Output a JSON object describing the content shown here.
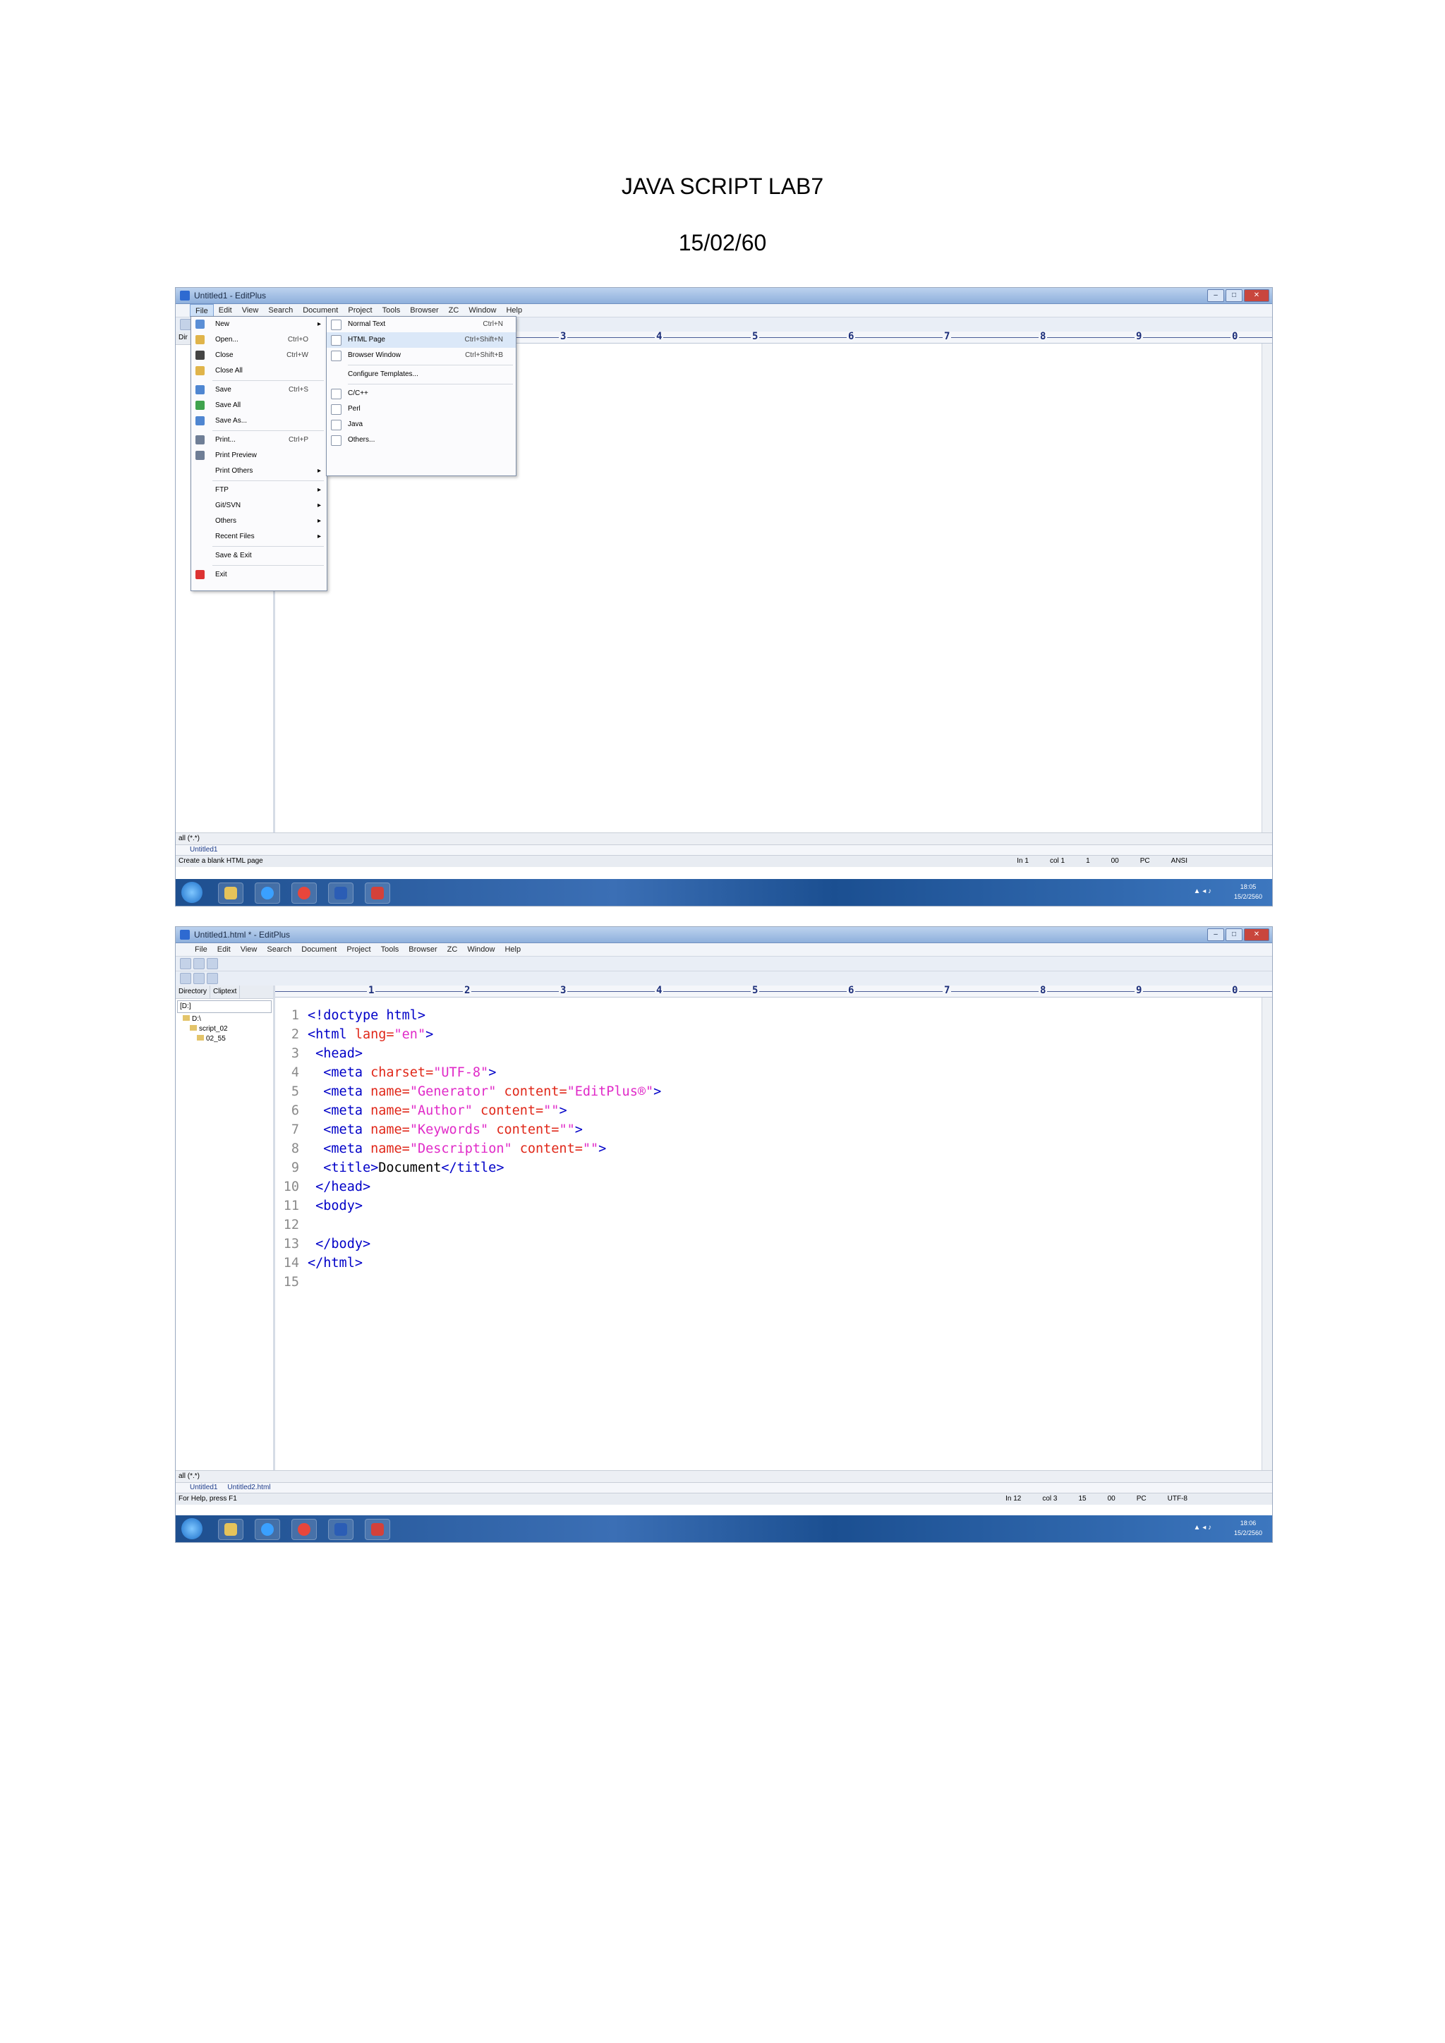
{
  "document": {
    "title": "JAVA SCRIPT LAB7",
    "date": "15/02/60"
  },
  "screenshot1": {
    "window_title": "Untitled1 - EditPlus",
    "menu": [
      "File",
      "Edit",
      "View",
      "Search",
      "Document",
      "Project",
      "Tools",
      "Browser",
      "ZC",
      "Window",
      "Help"
    ],
    "file_menu": [
      {
        "label": "New",
        "shortcut": "",
        "arrow": "▸"
      },
      {
        "label": "Open...",
        "shortcut": "Ctrl+O",
        "arrow": ""
      },
      {
        "label": "Close",
        "shortcut": "Ctrl+W",
        "arrow": ""
      },
      {
        "label": "Close All",
        "shortcut": "",
        "arrow": ""
      },
      {
        "label": "Save",
        "shortcut": "Ctrl+S",
        "arrow": ""
      },
      {
        "label": "Save All",
        "shortcut": "",
        "arrow": ""
      },
      {
        "label": "Save As...",
        "shortcut": "",
        "arrow": ""
      },
      {
        "label": "Print...",
        "shortcut": "Ctrl+P",
        "arrow": ""
      },
      {
        "label": "Print Preview",
        "shortcut": "",
        "arrow": ""
      },
      {
        "label": "Print Others",
        "shortcut": "",
        "arrow": "▸"
      },
      {
        "label": "FTP",
        "shortcut": "",
        "arrow": "▸"
      },
      {
        "label": "Git/SVN",
        "shortcut": "",
        "arrow": "▸"
      },
      {
        "label": "Others",
        "shortcut": "",
        "arrow": "▸"
      },
      {
        "label": "Recent Files",
        "shortcut": "",
        "arrow": "▸"
      },
      {
        "label": "Save & Exit",
        "shortcut": "",
        "arrow": ""
      },
      {
        "label": "Exit",
        "shortcut": "",
        "arrow": ""
      }
    ],
    "new_submenu": [
      {
        "label": "Normal Text",
        "shortcut": "Ctrl+N"
      },
      {
        "label": "HTML Page",
        "shortcut": "Ctrl+Shift+N"
      },
      {
        "label": "Browser Window",
        "shortcut": "Ctrl+Shift+B"
      },
      {
        "label": "Configure Templates...",
        "shortcut": ""
      },
      {
        "label": "C/C++",
        "shortcut": ""
      },
      {
        "label": "Perl",
        "shortcut": ""
      },
      {
        "label": "Java",
        "shortcut": ""
      },
      {
        "label": "Others...",
        "shortcut": ""
      }
    ],
    "filter": "all (*.*)",
    "doc_tab": "Untitled1",
    "status_text": "Create a blank HTML page",
    "status_right": [
      "In 1",
      "col 1",
      "1",
      "00",
      "PC",
      "ANSI"
    ],
    "clock": {
      "time": "18:05",
      "date": "15/2/2560"
    }
  },
  "screenshot2": {
    "window_title": "Untitled1.html * - EditPlus",
    "menu": [
      "File",
      "Edit",
      "View",
      "Search",
      "Document",
      "Project",
      "Tools",
      "Browser",
      "ZC",
      "Window",
      "Help"
    ],
    "panel_tabs": [
      "Directory",
      "Cliptext"
    ],
    "drive": "[D:]",
    "tree": [
      "D:\\",
      "script_02",
      "02_55"
    ],
    "filter": "all (*.*)",
    "doc_tabs": [
      "Untitled1",
      "Untitled2.html"
    ],
    "code": [
      [
        {
          "c": "tag",
          "t": "<!doctype html>"
        }
      ],
      [
        {
          "c": "tag",
          "t": "<html "
        },
        {
          "c": "attr",
          "t": "lang="
        },
        {
          "c": "val",
          "t": "\"en\""
        },
        {
          "c": "tag",
          "t": ">"
        }
      ],
      [
        {
          "c": "tag",
          "t": " <head>"
        }
      ],
      [
        {
          "c": "tag",
          "t": "  <meta "
        },
        {
          "c": "attr",
          "t": "charset="
        },
        {
          "c": "val",
          "t": "\"UTF-8\""
        },
        {
          "c": "tag",
          "t": ">"
        }
      ],
      [
        {
          "c": "tag",
          "t": "  <meta "
        },
        {
          "c": "attr",
          "t": "name="
        },
        {
          "c": "val",
          "t": "\"Generator\""
        },
        {
          "c": "attr",
          "t": " content="
        },
        {
          "c": "val",
          "t": "\"EditPlus®\""
        },
        {
          "c": "tag",
          "t": ">"
        }
      ],
      [
        {
          "c": "tag",
          "t": "  <meta "
        },
        {
          "c": "attr",
          "t": "name="
        },
        {
          "c": "val",
          "t": "\"Author\""
        },
        {
          "c": "attr",
          "t": " content="
        },
        {
          "c": "val",
          "t": "\"\""
        },
        {
          "c": "tag",
          "t": ">"
        }
      ],
      [
        {
          "c": "tag",
          "t": "  <meta "
        },
        {
          "c": "attr",
          "t": "name="
        },
        {
          "c": "val",
          "t": "\"Keywords\""
        },
        {
          "c": "attr",
          "t": " content="
        },
        {
          "c": "val",
          "t": "\"\""
        },
        {
          "c": "tag",
          "t": ">"
        }
      ],
      [
        {
          "c": "tag",
          "t": "  <meta "
        },
        {
          "c": "attr",
          "t": "name="
        },
        {
          "c": "val",
          "t": "\"Description\""
        },
        {
          "c": "attr",
          "t": " content="
        },
        {
          "c": "val",
          "t": "\"\""
        },
        {
          "c": "tag",
          "t": ">"
        }
      ],
      [
        {
          "c": "tag",
          "t": "  <title>"
        },
        {
          "c": "txt",
          "t": "Document"
        },
        {
          "c": "tag",
          "t": "</title>"
        }
      ],
      [
        {
          "c": "tag",
          "t": " </head>"
        }
      ],
      [
        {
          "c": "tag",
          "t": " <body>"
        }
      ],
      [],
      [
        {
          "c": "tag",
          "t": " </body>"
        }
      ],
      [
        {
          "c": "tag",
          "t": "</html>"
        }
      ],
      []
    ],
    "status_text": "For Help, press F1",
    "status_right": [
      "In 12",
      "col 3",
      "15",
      "00",
      "PC",
      "UTF-8"
    ],
    "clock": {
      "time": "18:06",
      "date": "15/2/2560"
    }
  },
  "ruler_numbers": [
    "1",
    "2",
    "3",
    "4",
    "5",
    "6",
    "7",
    "8",
    "9",
    "0"
  ]
}
